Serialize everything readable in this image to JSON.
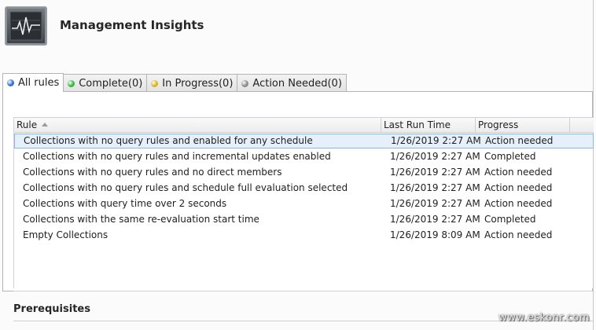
{
  "header": {
    "title": "Management Insights",
    "icon": "monitor-chart-icon"
  },
  "tabs": [
    {
      "label": "All rules",
      "dot_color": "#2f6fd0",
      "active": true
    },
    {
      "label": "Complete(0)",
      "dot_color": "#35b53a",
      "active": false
    },
    {
      "label": "In Progress(0)",
      "dot_color": "#d9b21e",
      "active": false
    },
    {
      "label": "Action Needed(0)",
      "dot_color": "#8a8a8a",
      "active": false
    }
  ],
  "grid": {
    "columns": [
      "Rule",
      "Last Run Time",
      "Progress"
    ],
    "sort_column": "Rule",
    "sort_direction": "ascending",
    "rows": [
      {
        "rule": "Collections with no query rules and enabled for any schedule",
        "last_run": "1/26/2019 2:27 AM",
        "progress": "Action needed",
        "selected": true
      },
      {
        "rule": "Collections with no query rules and incremental updates enabled",
        "last_run": "1/26/2019 2:27 AM",
        "progress": "Completed",
        "selected": false
      },
      {
        "rule": "Collections with no query rules and no direct members",
        "last_run": "1/26/2019 2:27 AM",
        "progress": "Action needed",
        "selected": false
      },
      {
        "rule": "Collections with no query rules and schedule full evaluation selected",
        "last_run": "1/26/2019 2:27 AM",
        "progress": "Action needed",
        "selected": false
      },
      {
        "rule": "Collections with query time over 2 seconds",
        "last_run": "1/26/2019 2:27 AM",
        "progress": "Action needed",
        "selected": false
      },
      {
        "rule": "Collections with the same re-evaluation start time",
        "last_run": "1/26/2019 2:27 AM",
        "progress": "Completed",
        "selected": false
      },
      {
        "rule": "Empty Collections",
        "last_run": "1/26/2019 8:09 AM",
        "progress": "Action needed",
        "selected": false
      }
    ]
  },
  "prerequisites": {
    "title": "Prerequisites"
  },
  "watermark": "www.eskonr.com",
  "colors": {
    "selection_bg": "#e6f0fb",
    "selection_border": "#88b6e6"
  }
}
